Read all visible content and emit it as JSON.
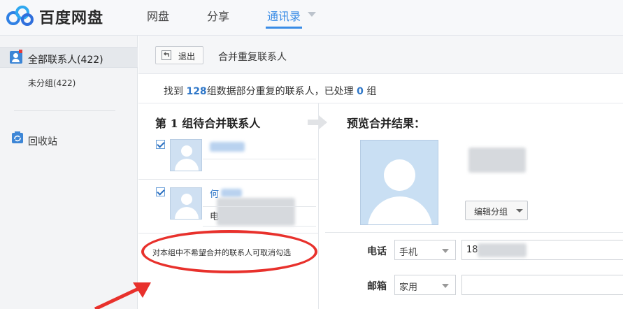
{
  "header": {
    "logo_text": "百度网盘",
    "nav": [
      {
        "label": "网盘",
        "active": false
      },
      {
        "label": "分享",
        "active": false
      },
      {
        "label": "通讯录",
        "active": true
      }
    ],
    "accent_color": "#3a8ce6"
  },
  "sidebar": {
    "all_contacts": "全部联系人(422)",
    "ungrouped": "未分组(422)",
    "trash": "回收站"
  },
  "toolbar": {
    "back_label": "退出",
    "title": "合并重复联系人"
  },
  "summary": {
    "prefix": "找到",
    "group_count": "128",
    "middle": "组数据部分重复的联系人，已处理",
    "processed": "0",
    "suffix": "组"
  },
  "merge": {
    "group_title": "第 1 组待合并联系人",
    "contacts": [
      {
        "checked": true
      },
      {
        "checked": true,
        "name_fragment": "何",
        "phone_label": "电"
      }
    ],
    "hint": "对本组中不希望合并的联系人可取消勾选"
  },
  "preview": {
    "title": "预览合并结果：",
    "edit_group_label": "编辑分组",
    "phone": {
      "label": "电话",
      "type": "手机",
      "value_prefix": "18"
    },
    "email": {
      "label": "邮箱",
      "type": "家用",
      "value": ""
    }
  },
  "annotation_color": "#e8312c"
}
